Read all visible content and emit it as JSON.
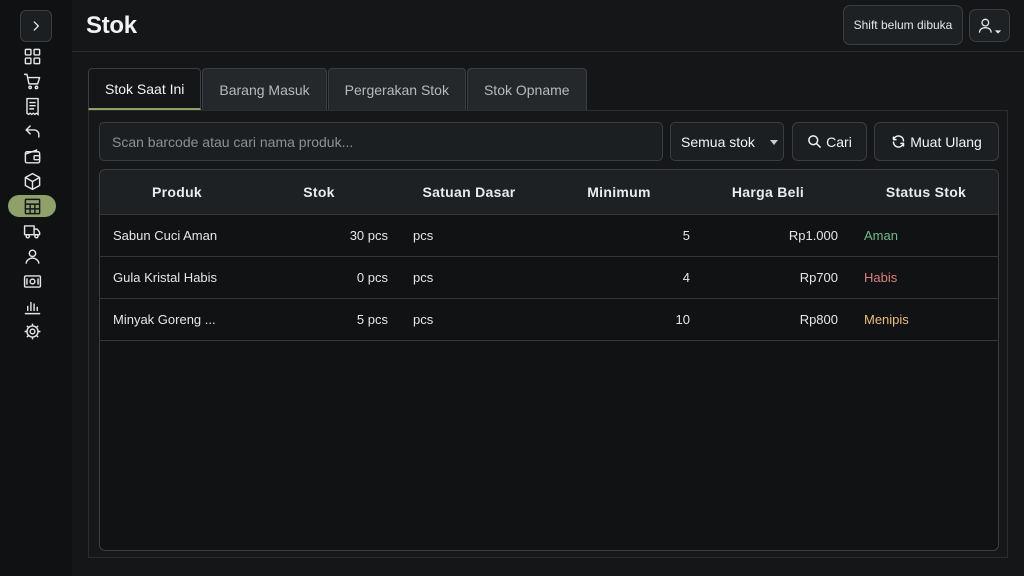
{
  "page": {
    "title": "Stok"
  },
  "header": {
    "shift_label": "Shift belum dibuka"
  },
  "sidebar": {
    "items": [
      {
        "icon": "dashboard-icon"
      },
      {
        "icon": "cart-icon"
      },
      {
        "icon": "receipt-icon"
      },
      {
        "icon": "return-icon"
      },
      {
        "icon": "wallet-icon"
      },
      {
        "icon": "box-icon"
      },
      {
        "icon": "table-icon",
        "active": true
      },
      {
        "icon": "truck-icon"
      },
      {
        "icon": "user-icon"
      },
      {
        "icon": "cash-icon"
      },
      {
        "icon": "chart-icon"
      },
      {
        "icon": "gear-icon"
      }
    ]
  },
  "tabs": [
    {
      "label": "Stok Saat Ini",
      "active": true
    },
    {
      "label": "Barang Masuk"
    },
    {
      "label": "Pergerakan Stok"
    },
    {
      "label": "Stok Opname"
    }
  ],
  "toolbar": {
    "search_placeholder": "Scan barcode atau cari nama produk...",
    "filter_value": "Semua stok",
    "search_button": "Cari",
    "reload_button": "Muat Ulang"
  },
  "table": {
    "headers": {
      "produk": "Produk",
      "stok": "Stok",
      "satuan": "Satuan Dasar",
      "minimum": "Minimum",
      "harga": "Harga Beli",
      "status": "Status Stok"
    },
    "rows": [
      {
        "produk": "Sabun Cuci Aman",
        "stok": "30 pcs",
        "satuan": "pcs",
        "minimum": "5",
        "harga": "Rp1.000",
        "status": "Aman"
      },
      {
        "produk": "Gula Kristal Habis",
        "stok": "0 pcs",
        "satuan": "pcs",
        "minimum": "4",
        "harga": "Rp700",
        "status": "Habis"
      },
      {
        "produk": "Minyak Goreng ...",
        "stok": "5 pcs",
        "satuan": "pcs",
        "minimum": "10",
        "harga": "Rp800",
        "status": "Menipis"
      }
    ]
  },
  "colors": {
    "accent": "#8fa06a",
    "status_aman": "#6fba8c",
    "status_habis": "#e07d7d",
    "status_menipis": "#e8c07a"
  }
}
